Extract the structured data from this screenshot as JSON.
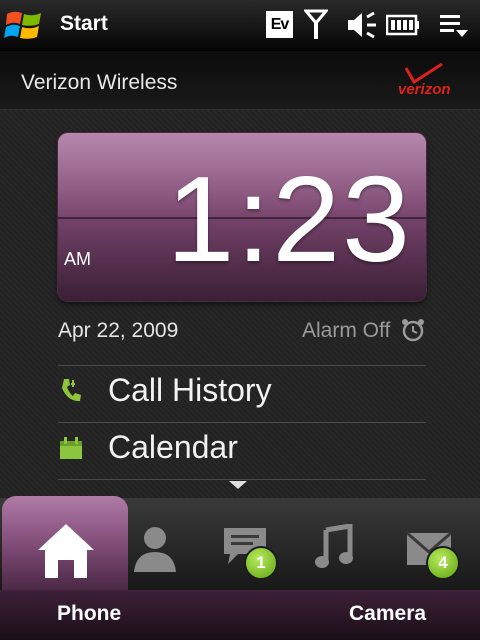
{
  "statusbar": {
    "title": "Start",
    "network_badge": "Ev",
    "icons": [
      "windows-flag-icon",
      "signal-icon",
      "volume-icon",
      "battery-icon",
      "menu-icon"
    ]
  },
  "carrier": {
    "name": "Verizon Wireless",
    "logo_text": "verizon"
  },
  "clock": {
    "time": "1:23",
    "ampm": "AM",
    "date": "Apr 22, 2009",
    "alarm": "Alarm Off"
  },
  "menu": [
    {
      "label": "Call History",
      "icon": "call-history-icon",
      "color": "#8cc63f"
    },
    {
      "label": "Calendar",
      "icon": "calendar-icon",
      "color": "#8cc63f"
    }
  ],
  "tabs": [
    {
      "name": "home",
      "icon": "home-icon",
      "active": true
    },
    {
      "name": "people",
      "icon": "contact-icon"
    },
    {
      "name": "messages",
      "icon": "message-icon",
      "badge": "1"
    },
    {
      "name": "music",
      "icon": "music-icon"
    },
    {
      "name": "email",
      "icon": "mail-icon",
      "badge": "4"
    }
  ],
  "softkeys": {
    "left": "Phone",
    "right": "Camera"
  },
  "colors": {
    "accent": "#8e5784",
    "badge": "#7cc42a",
    "menu_icon": "#8cc63f"
  }
}
